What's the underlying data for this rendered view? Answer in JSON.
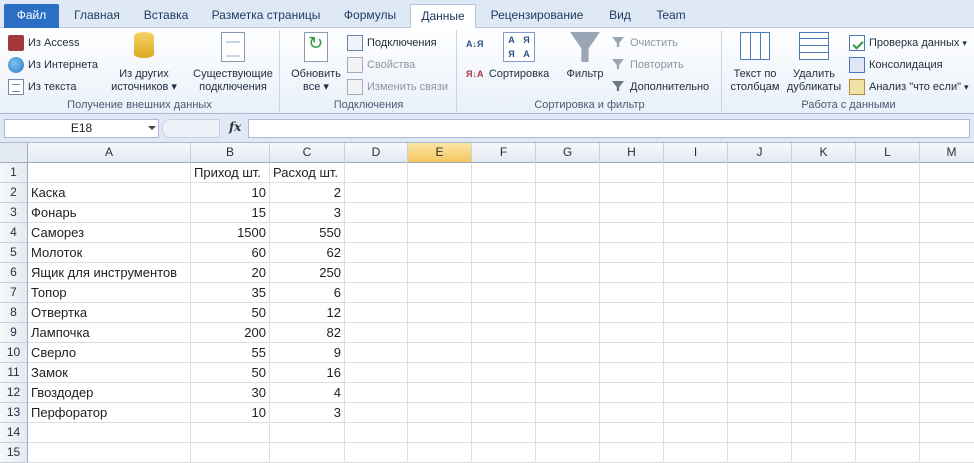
{
  "tabs": [
    {
      "label": "Файл",
      "kind": "file"
    },
    {
      "label": "Главная"
    },
    {
      "label": "Вставка"
    },
    {
      "label": "Разметка страницы"
    },
    {
      "label": "Формулы"
    },
    {
      "label": "Данные",
      "active": true
    },
    {
      "label": "Рецензирование"
    },
    {
      "label": "Вид"
    },
    {
      "label": "Team"
    }
  ],
  "ribbon": {
    "external": {
      "from_access": "Из Access",
      "from_web": "Из Интернета",
      "from_text": "Из текста",
      "from_other_1": "Из других",
      "from_other_2": "источников",
      "existing_1": "Существующие",
      "existing_2": "подключения",
      "label": "Получение внешних данных"
    },
    "connections": {
      "refresh_1": "Обновить",
      "refresh_2": "все",
      "connections": "Подключения",
      "properties": "Свойства",
      "edit_links": "Изменить связи",
      "label": "Подключения"
    },
    "sortfilter": {
      "sort_az": "А↓Я",
      "sort_za": "Я↓А",
      "sort": "Сортировка",
      "filter": "Фильтр",
      "clear": "Очистить",
      "reapply": "Повторить",
      "advanced": "Дополнительно",
      "label": "Сортировка и фильтр"
    },
    "datatools": {
      "text_to_columns_1": "Текст по",
      "text_to_columns_2": "столбцам",
      "remove_dup_1": "Удалить",
      "remove_dup_2": "дубликаты",
      "validation": "Проверка данных",
      "consolidation": "Консолидация",
      "whatif": "Анализ \"что если\"",
      "label": "Работа с данными"
    }
  },
  "formula_bar": {
    "name_box": "E18",
    "fx": "fx",
    "formula": ""
  },
  "sheet": {
    "columns": [
      "A",
      "B",
      "C",
      "D",
      "E",
      "F",
      "G",
      "H",
      "I",
      "J",
      "K",
      "L",
      "M"
    ],
    "selected_column": "E",
    "rows": [
      [
        "",
        "Приход шт.",
        "Расход шт."
      ],
      [
        "Каска",
        "10",
        "2"
      ],
      [
        "Фонарь",
        "15",
        "3"
      ],
      [
        "Саморез",
        "1500",
        "550"
      ],
      [
        "Молоток",
        "60",
        "62"
      ],
      [
        "Ящик для инструментов",
        "20",
        "250"
      ],
      [
        "Топор",
        "35",
        "6"
      ],
      [
        "Отвертка",
        "50",
        "12"
      ],
      [
        "Лампочка",
        "200",
        "82"
      ],
      [
        "Сверло",
        "55",
        "9"
      ],
      [
        "Замок",
        "50",
        "16"
      ],
      [
        "Гвоздодер",
        "30",
        "4"
      ],
      [
        "Перфоратор",
        "10",
        "3"
      ],
      [
        "",
        "",
        ""
      ],
      [
        "",
        "",
        ""
      ]
    ],
    "row_numbers": [
      "1",
      "2",
      "3",
      "4",
      "5",
      "6",
      "7",
      "8",
      "9",
      "10",
      "11",
      "12",
      "13",
      "14",
      "15"
    ]
  }
}
